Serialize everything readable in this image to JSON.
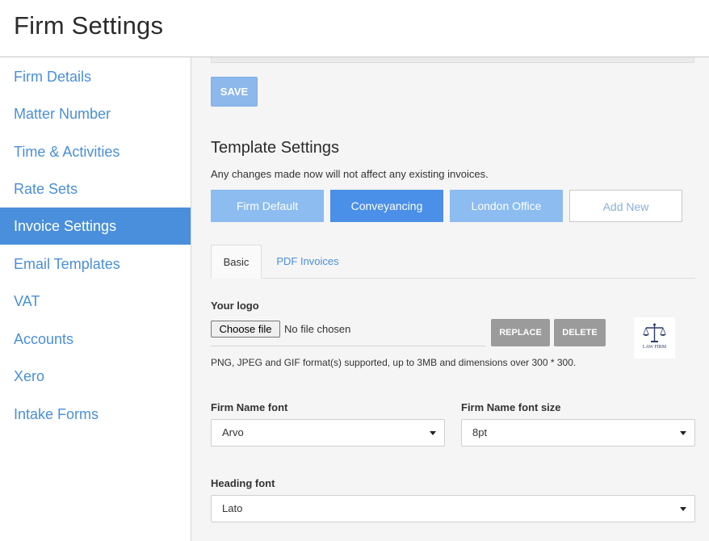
{
  "header": {
    "title": "Firm Settings"
  },
  "sidebar": {
    "items": [
      {
        "label": "Firm Details"
      },
      {
        "label": "Matter Number"
      },
      {
        "label": "Time & Activities"
      },
      {
        "label": "Rate Sets"
      },
      {
        "label": "Invoice Settings"
      },
      {
        "label": "Email Templates"
      },
      {
        "label": "VAT"
      },
      {
        "label": "Accounts"
      },
      {
        "label": "Xero"
      },
      {
        "label": "Intake Forms"
      }
    ],
    "active": "Invoice Settings"
  },
  "main": {
    "save_label": "SAVE",
    "template": {
      "title": "Template Settings",
      "note": "Any changes made now will not affect any existing invoices.",
      "buttons": [
        {
          "label": "Firm Default"
        },
        {
          "label": "Conveyancing"
        },
        {
          "label": "London Office"
        },
        {
          "label": "Add New"
        }
      ],
      "selected": "Conveyancing"
    },
    "tabs": [
      {
        "label": "Basic"
      },
      {
        "label": "PDF Invoices"
      }
    ],
    "logo": {
      "label": "Your logo",
      "choose_label": "Choose file",
      "file_status": "No file chosen",
      "replace_label": "REPLACE",
      "delete_label": "DELETE",
      "preview_text": "LAW FIRM",
      "help": "PNG, JPEG and GIF format(s) supported, up to 3MB and dimensions over 300 * 300."
    },
    "fields": {
      "firm_name_font": {
        "label": "Firm Name font",
        "value": "Arvo"
      },
      "firm_name_font_size": {
        "label": "Firm Name font size",
        "value": "8pt"
      },
      "heading_font": {
        "label": "Heading font",
        "value": "Lato"
      }
    }
  },
  "colors": {
    "accent": "#4a8fdc",
    "link": "#4a8fd9",
    "light_button": "#8cbcf0",
    "gray_button": "#9b9b9b"
  }
}
